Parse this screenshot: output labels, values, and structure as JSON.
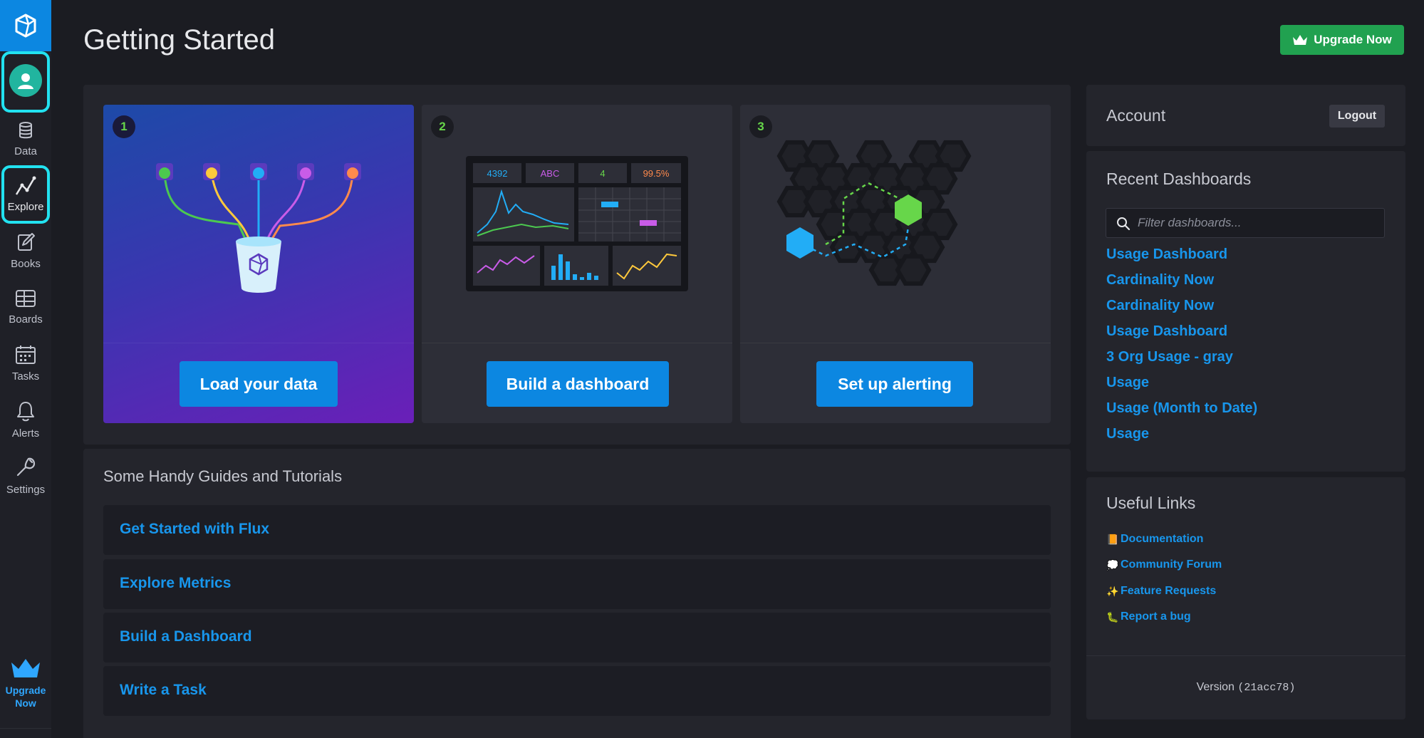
{
  "app": {
    "page_title": "Getting Started",
    "upgrade_button": "Upgrade Now"
  },
  "sidebar": {
    "items": [
      {
        "label": "Data",
        "icon": "database-icon"
      },
      {
        "label": "Explore",
        "icon": "graph-icon"
      },
      {
        "label": "Books",
        "icon": "notebook-icon"
      },
      {
        "label": "Boards",
        "icon": "dashboard-icon"
      },
      {
        "label": "Tasks",
        "icon": "calendar-icon"
      },
      {
        "label": "Alerts",
        "icon": "bell-icon"
      },
      {
        "label": "Settings",
        "icon": "wrench-icon"
      }
    ],
    "upgrade": {
      "line1": "Upgrade",
      "line2": "Now"
    },
    "highlight_color": "#22e2f0"
  },
  "steps": [
    {
      "number": "1",
      "cta": "Load your data"
    },
    {
      "number": "2",
      "cta": "Build a dashboard"
    },
    {
      "number": "3",
      "cta": "Set up alerting"
    }
  ],
  "dashboard_preview": {
    "stats": [
      "4392",
      "ABC",
      "4",
      "99.5%"
    ]
  },
  "guides": {
    "title": "Some Handy Guides and Tutorials",
    "items": [
      "Get Started with Flux",
      "Explore Metrics",
      "Build a Dashboard",
      "Write a Task"
    ]
  },
  "account": {
    "title": "Account",
    "logout": "Logout"
  },
  "recent_dashboards": {
    "title": "Recent Dashboards",
    "filter_placeholder": "Filter dashboards...",
    "items": [
      "Usage Dashboard",
      "Cardinality Now",
      "Cardinality Now",
      "Usage Dashboard",
      "3 Org Usage - gray",
      "Usage",
      "Usage (Month to Date)",
      "Usage"
    ]
  },
  "useful_links": {
    "title": "Useful Links",
    "items": [
      {
        "emoji": "📙",
        "label": "Documentation"
      },
      {
        "emoji": "💭",
        "label": "Community Forum"
      },
      {
        "emoji": "✨",
        "label": "Feature Requests"
      },
      {
        "emoji": "🐛",
        "label": "Report a bug"
      }
    ]
  },
  "version": {
    "label": "Version",
    "code": "(21acc78)"
  },
  "colors": {
    "accent": "#0c87e1",
    "link": "#1896ec",
    "upgrade": "#21a150",
    "background": "#1b1c22"
  }
}
